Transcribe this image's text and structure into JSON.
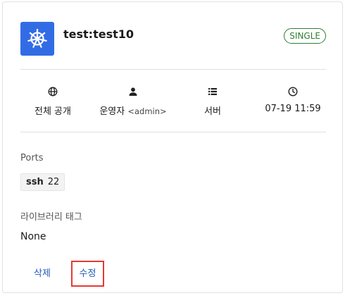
{
  "card": {
    "title": "test:test10",
    "type_badge": "SINGLE",
    "logo_icon": "kubernetes-helm-icon"
  },
  "meta": {
    "visibility": {
      "icon": "globe-icon",
      "label": "전체 공개"
    },
    "owner": {
      "icon": "user-icon",
      "label": "운영자",
      "detail": "<admin>"
    },
    "kind": {
      "icon": "list-icon",
      "label": "서버"
    },
    "updated": {
      "icon": "clock-icon",
      "label": "07-19 11:59"
    }
  },
  "ports": {
    "label": "Ports",
    "items": [
      {
        "name": "ssh",
        "number": "22"
      }
    ]
  },
  "tags": {
    "label": "라이브러리 태그",
    "value": "None"
  },
  "actions": {
    "delete_label": "삭제",
    "edit_label": "수정"
  },
  "colors": {
    "brand": "#326ce5",
    "badge": "#2e7d32",
    "link": "#1e5bb8",
    "highlight": "#e53935"
  }
}
